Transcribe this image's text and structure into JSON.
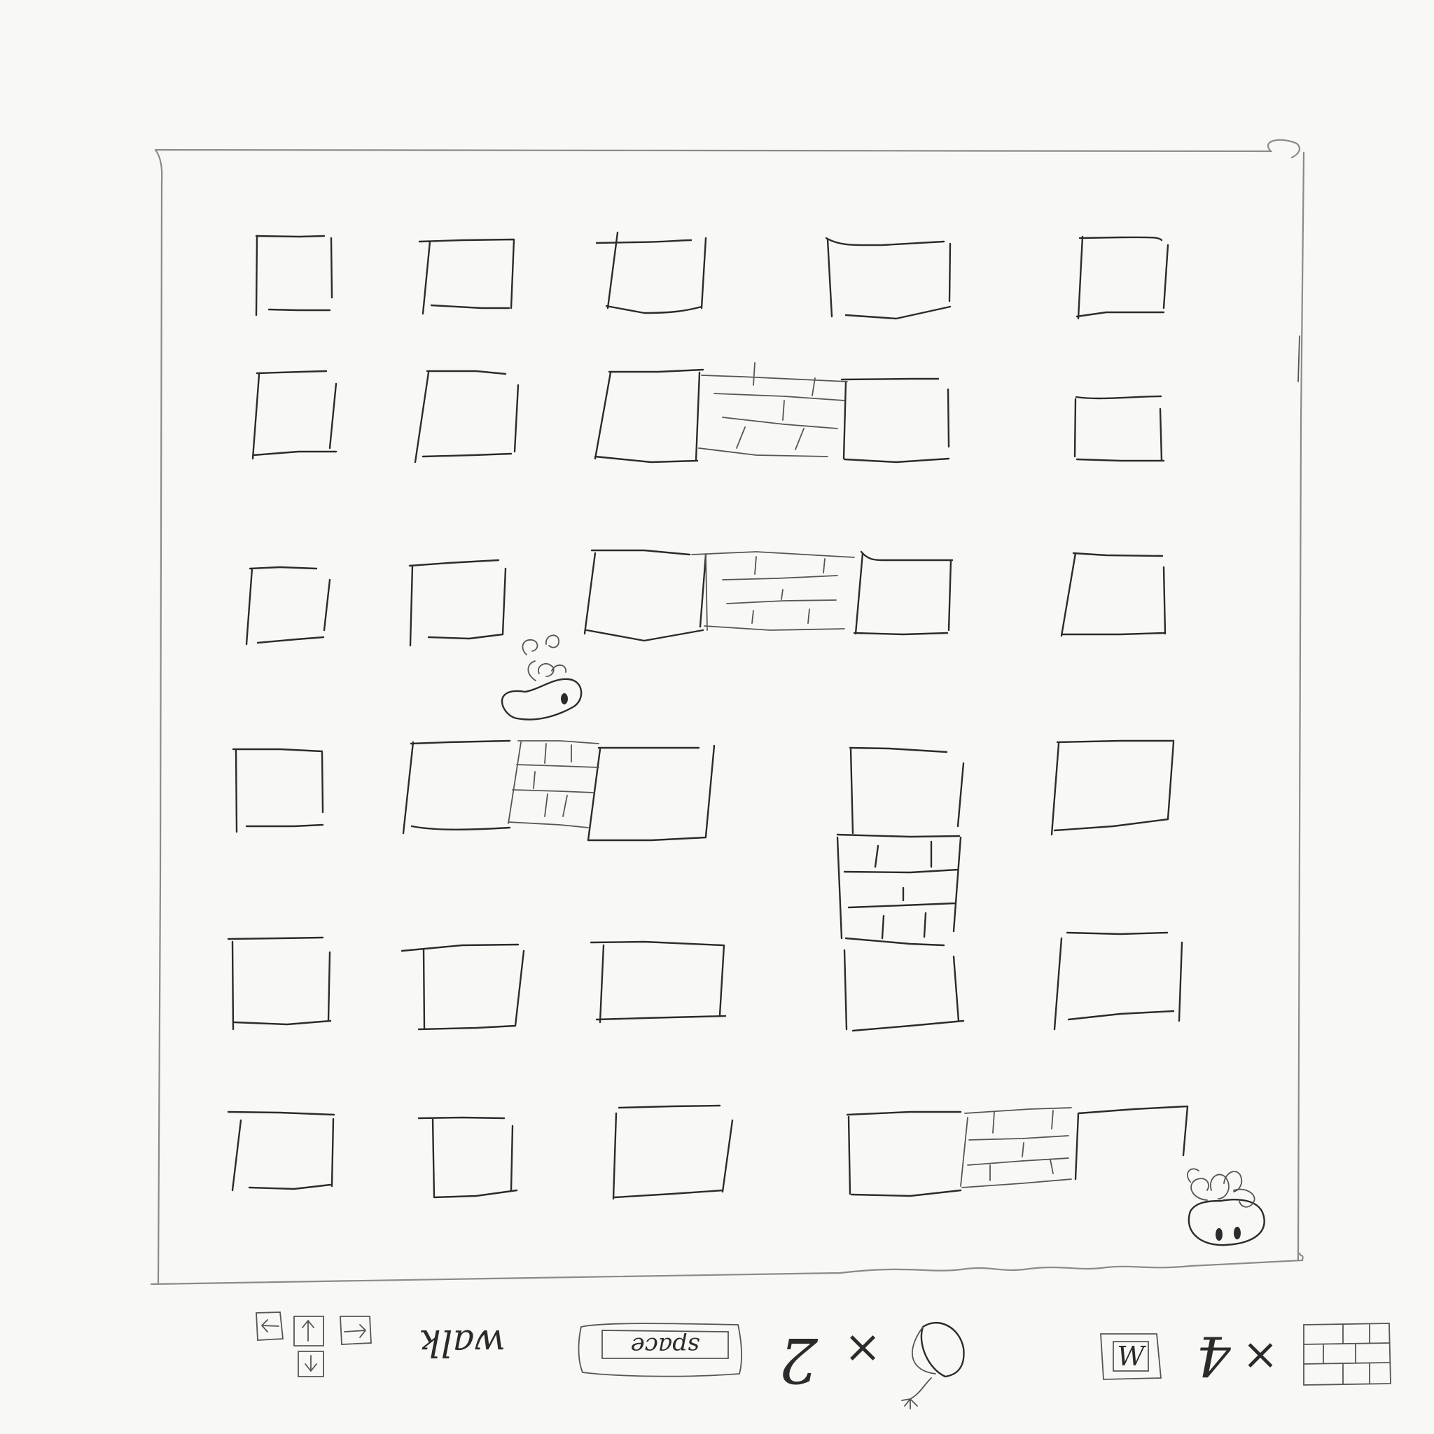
{
  "game": {
    "title": "",
    "player": {
      "name": "player-character",
      "facing": "right"
    },
    "enemy": {
      "name": "enemy-character",
      "facing": "front"
    }
  },
  "legend": {
    "walk_label": "walk",
    "space_key_label": "space",
    "balloon_count_label": "2",
    "multiply_symbol": "×",
    "w_key_label": "W",
    "brick_count_label": "4"
  },
  "colors": {
    "background": "#f8f9f5",
    "ink": "#2b2b2b",
    "border": "#8a8a8a"
  }
}
